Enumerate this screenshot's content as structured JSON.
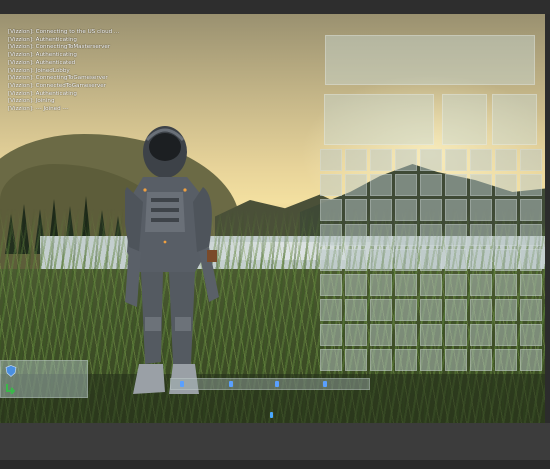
{
  "console": {
    "lines": [
      "[Vizzion]: Connecting to the US cloud ...",
      "[Vizzion]: Authenticating",
      "[Vizzion]: ConnectingToMasterserver",
      "[Vizzion]: Authenticating",
      "[Vizzion]: Authenticated",
      "[Vizzion]: JoinedLobby",
      "[Vizzion]: ConnectingToGameserver",
      "[Vizzion]: ConnectedToGameserver",
      "[Vizzion]: Authenticating",
      "[Vizzion]: Joining",
      "[Vizzion]: --- Joined ---"
    ]
  },
  "inventory": {
    "slot_count": 81
  },
  "status": {
    "shield_icon": "shield-icon",
    "arrow_icon": "arrow-icon",
    "shield_color": "#4a8fe0",
    "arrow_color": "#3ab84a"
  },
  "hotbar": {
    "item_color": "#5aa0ff"
  },
  "colors": {
    "panel": "#c8d7d2",
    "log_text": "#ffffff"
  }
}
